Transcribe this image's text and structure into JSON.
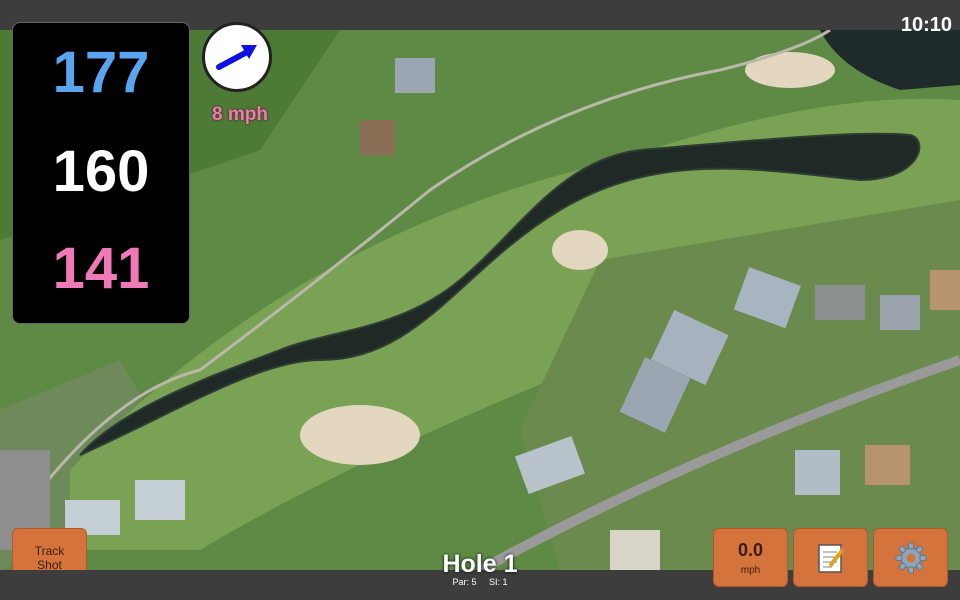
{
  "clock": "10:10",
  "distances": {
    "back": "177",
    "middle": "160",
    "front": "141"
  },
  "wind": {
    "speed": "8 mph",
    "direction_icon": "wind-arrow-icon"
  },
  "buttons": {
    "track_shot": "Track\nShot",
    "speed_value": "0.0",
    "speed_unit": "mph",
    "notes_icon": "notepad-icon",
    "settings_icon": "gear-icon"
  },
  "hole": {
    "title": "Hole 1",
    "par": "Par: 5",
    "si": "SI: 1"
  },
  "colors": {
    "back": "#5ba4f0",
    "middle": "#ffffff",
    "front": "#f07ab8",
    "button": "#d4743c"
  }
}
